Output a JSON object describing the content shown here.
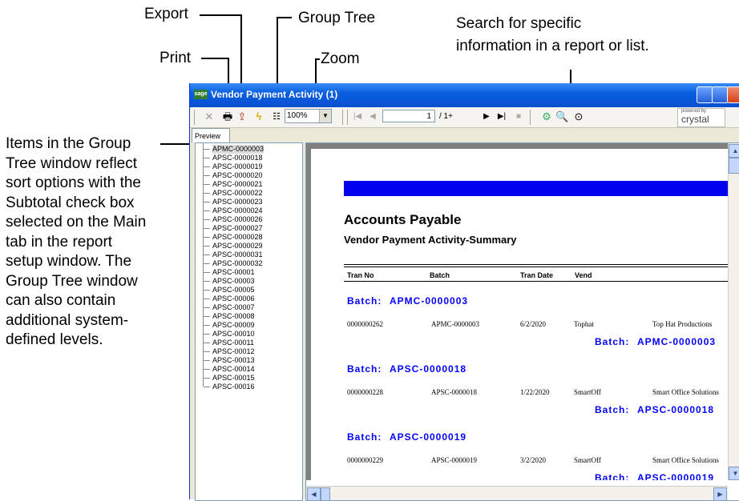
{
  "callouts": {
    "export": "Export",
    "print": "Print",
    "group_tree": "Group Tree",
    "zoom": "Zoom",
    "search_line1": "Search for specific",
    "search_line2": "information in a report or list.",
    "items_lines": [
      "Items in the Group",
      "Tree window reflect",
      "sort options with the",
      "Subtotal check box",
      "selected on the Main",
      "tab in the report",
      "setup window. The",
      "Group Tree window",
      "can also contain",
      "additional system-",
      "defined levels."
    ]
  },
  "window": {
    "logo_text": "sage",
    "title": "Vendor Payment Activity (1)"
  },
  "toolbar": {
    "icons": [
      "close-icon",
      "print-icon",
      "export-icon",
      "refresh-icon",
      "group-tree-icon"
    ],
    "zoom_value": "100%",
    "page_value": "1",
    "page_of": "/ 1+",
    "brand_small": "powered by",
    "brand": "crystal"
  },
  "tabs": [
    "Preview"
  ],
  "tree": {
    "items": [
      "APMC-0000003",
      "APSC-0000018",
      "APSC-0000019",
      "APSC-0000020",
      "APSC-0000021",
      "APSC-0000022",
      "APSC-0000023",
      "APSC-0000024",
      "APSC-0000026",
      "APSC-0000027",
      "APSC-0000028",
      "APSC-0000029",
      "APSC-0000031",
      "APSC-0000032",
      "APSC-00001",
      "APSC-00003",
      "APSC-00005",
      "APSC-00006",
      "APSC-00007",
      "APSC-00008",
      "APSC-00009",
      "APSC-00010",
      "APSC-00011",
      "APSC-00012",
      "APSC-00013",
      "APSC-00014",
      "APSC-00015",
      "APSC-00016"
    ],
    "selected_index": 0
  },
  "report": {
    "title": "Accounts Payable",
    "subtitle": "Vendor Payment Activity-Summary",
    "columns": [
      "Tran No",
      "Batch",
      "Tran Date",
      "Vend"
    ],
    "batch_label": "Batch:",
    "groups": [
      {
        "batch": "APMC-0000003",
        "tran_no": "0000000262",
        "batch_cell": "APMC-0000003",
        "date": "6/2/2020",
        "vend": "Tophat",
        "vendor_name": "Top Hat Productions"
      },
      {
        "batch": "APSC-0000018",
        "tran_no": "0000000228",
        "batch_cell": "APSC-0000018",
        "date": "1/22/2020",
        "vend": "SmartOff",
        "vendor_name": "Smart Office Solutions"
      },
      {
        "batch": "APSC-0000019",
        "tran_no": "0000000229",
        "batch_cell": "APSC-0000019",
        "date": "3/2/2020",
        "vend": "SmartOff",
        "vendor_name": "Smart Office Solutions"
      }
    ]
  }
}
